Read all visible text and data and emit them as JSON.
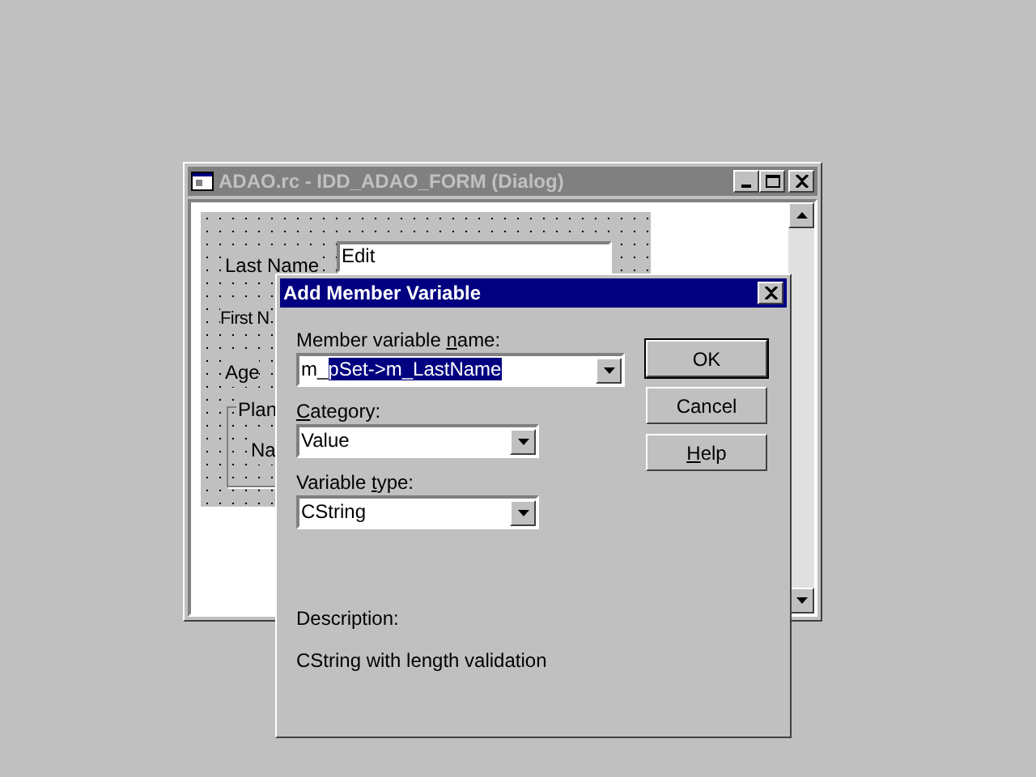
{
  "editor_window": {
    "title": "ADAO.rc - IDD_ADAO_FORM (Dialog)",
    "active": false,
    "form": {
      "labels": [
        {
          "text": "Last Name"
        },
        {
          "text": "First N"
        },
        {
          "text": "Age"
        }
      ],
      "edit_control": "Edit",
      "group_box": {
        "title": "Plan",
        "label": "Na"
      }
    }
  },
  "dialog": {
    "title": "Add Member Variable",
    "active": true,
    "fields": [
      {
        "label": [
          {
            "text": "Member variable ",
            "underlined": false
          },
          {
            "text": "n",
            "underlined": true
          },
          {
            "text": "ame:",
            "underlined": false
          }
        ],
        "value": [
          {
            "text": "m_",
            "selected": false
          },
          {
            "text": "pSet->m_LastName",
            "selected": true
          }
        ]
      },
      {
        "label": [
          {
            "text": "C",
            "underlined": true
          },
          {
            "text": "ategory:",
            "underlined": false
          }
        ],
        "value": [
          {
            "text": "Value",
            "selected": false
          }
        ]
      },
      {
        "label": [
          {
            "text": "Variable ",
            "underlined": false
          },
          {
            "text": "t",
            "underlined": true
          },
          {
            "text": "ype:",
            "underlined": false
          }
        ],
        "value": [
          {
            "text": "CString",
            "selected": false
          }
        ]
      }
    ],
    "buttons": [
      {
        "label": [
          {
            "text": "OK",
            "underlined": false
          }
        ],
        "default": true
      },
      {
        "label": [
          {
            "text": "Cancel",
            "underlined": false
          }
        ],
        "default": false
      },
      {
        "label": [
          {
            "text": "H",
            "underlined": true
          },
          {
            "text": "elp",
            "underlined": false
          }
        ],
        "default": false
      }
    ],
    "description_label": "Description:",
    "description": "CString with length validation"
  }
}
